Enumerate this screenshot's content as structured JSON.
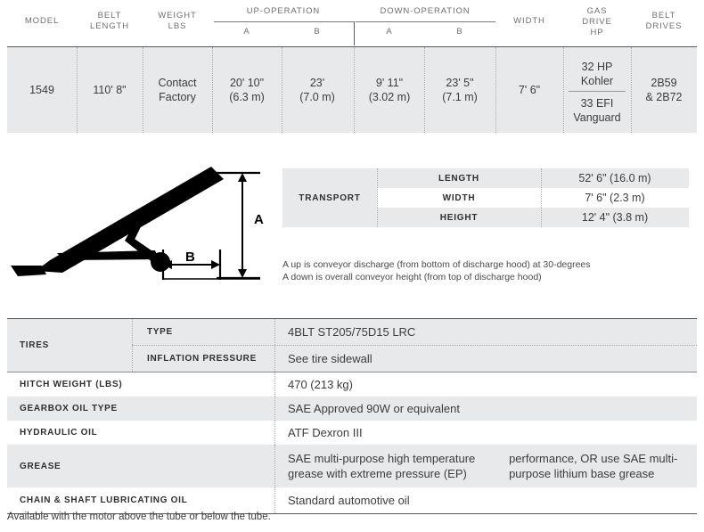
{
  "spec_table": {
    "headers": {
      "model": "MODEL",
      "belt_length": "BELT\nLENGTH",
      "belt_length_l1": "BELT",
      "belt_length_l2": "LENGTH",
      "weight_l1": "WEIGHT",
      "weight_l2": "LBS",
      "up_operation": "UP-OPERATION",
      "down_operation": "DOWN-OPERATION",
      "up_a": "A",
      "up_b": "B",
      "down_a": "A",
      "down_b": "B",
      "width": "WIDTH",
      "gas_drive_l1": "GAS",
      "gas_drive_l2": "DRIVE",
      "gas_drive_l3": "HP",
      "belt_drives_l1": "BELT",
      "belt_drives_l2": "DRIVES"
    },
    "row": {
      "model": "1549",
      "belt_length": "110' 8\"",
      "weight_l1": "Contact",
      "weight_l2": "Factory",
      "up_a_l1": "20' 10\"",
      "up_a_l2": "(6.3 m)",
      "up_b_l1": "23'",
      "up_b_l2": "(7.0 m)",
      "down_a_l1": "9' 11\"",
      "down_a_l2": "(3.02 m)",
      "down_b_l1": "23' 5\"",
      "down_b_l2": "(7.1 m)",
      "width": "7' 6\"",
      "gas_drive_1_l1": "32 HP",
      "gas_drive_1_l2": "Kohler",
      "gas_drive_2_l1": "33 EFI",
      "gas_drive_2_l2": "Vanguard",
      "belt_drives_l1": "2B59",
      "belt_drives_l2": "& 2B72"
    }
  },
  "diagram": {
    "label_a": "A",
    "label_b": "B"
  },
  "transport": {
    "label": "TRANSPORT",
    "rows": [
      {
        "name": "LENGTH",
        "value": "52' 6\" (16.0 m)",
        "shaded": true
      },
      {
        "name": "WIDTH",
        "value": "7' 6\" (2.3 m)",
        "shaded": false
      },
      {
        "name": "HEIGHT",
        "value": "12' 4\" (3.8 m)",
        "shaded": true
      }
    ]
  },
  "notes": {
    "line1": "A up is conveyor discharge (from bottom of discharge hood) at 30-degrees",
    "line2": "A down is overall conveyor height (from top of discharge hood)"
  },
  "lower_table": {
    "tires": {
      "label": "TIRES",
      "sub_rows": [
        {
          "label": "TYPE",
          "value": "4BLT ST205/75D15 LRC"
        },
        {
          "label": "INFLATION PRESSURE",
          "value": "See tire sidewall"
        }
      ]
    },
    "rows": [
      {
        "key": "HITCH WEIGHT (LBS)",
        "value": "470 (213 kg)",
        "shaded": false
      },
      {
        "key": "GEARBOX OIL TYPE",
        "value": "SAE Approved 90W or equivalent",
        "shaded": true
      },
      {
        "key": "HYDRAULIC OIL",
        "value": "ATF Dexron III",
        "shaded": false
      },
      {
        "key": "GREASE",
        "value_l1": "SAE multi-purpose high temperature grease with extreme pressure (EP)",
        "value_l2": "performance, OR use SAE multi-purpose lithium base grease",
        "shaded": true
      },
      {
        "key": "CHAIN & SHAFT LUBRICATING OIL",
        "value": "Standard automotive oil",
        "shaded": false
      }
    ]
  },
  "footnote": "Available with the motor above the tube or below the tube.",
  "colors": {
    "shade": "#e8e9ea",
    "rule_dark": "#58595b",
    "text": "#3c3c3c",
    "header_text": "#6e6e6e"
  }
}
